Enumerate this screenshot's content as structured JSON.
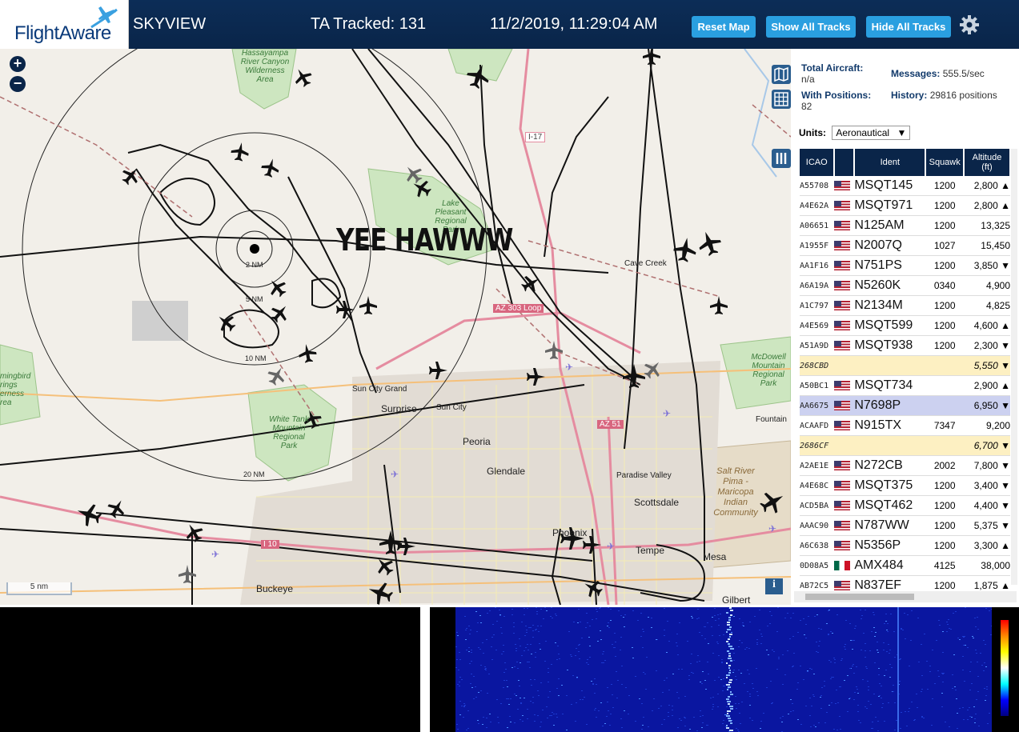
{
  "header": {
    "logo_text": "FlightAware",
    "title": "SKYVIEW",
    "tracked": "TA Tracked: 131",
    "datetime": "11/2/2019, 11:29:04 AM",
    "buttons": {
      "reset": "Reset Map",
      "show_all": "Show All Tracks",
      "hide_all": "Hide All Tracks"
    }
  },
  "map": {
    "overlay_text": "YEE HAWWW",
    "scale": "5 nm",
    "info": "i",
    "zoom_in": "+",
    "zoom_out": "−",
    "range_rings": [
      "2 NM",
      "5 NM",
      "10 NM",
      "20 NM"
    ],
    "places": {
      "surprise": "Surprise",
      "sun_city": "Sun City",
      "sun_city_grand": "Sun City Grand",
      "peoria": "Peoria",
      "glendale": "Glendale",
      "phoenix": "Phoenix",
      "scottsdale": "Scottsdale",
      "paradise_valley": "Paradise Valley",
      "tempe": "Tempe",
      "mesa": "Mesa",
      "buckeye": "Buckeye",
      "cave_creek": "Cave Creek",
      "fountain": "Fountain",
      "gilbert": "Gilbert",
      "hassayampa": "Hassayampa River Canyon Wilderness Area",
      "lake_pleasant": "Lake Pleasant Regional Park",
      "white_tank": "White Tank Mountain Regional Park",
      "mcdowell": "McDowell Mountain Regional Park",
      "salt_river": "Salt River Pima - Maricopa Indian Community",
      "hummingbird": "mingbird rings erness rea"
    },
    "roads": {
      "i17": "I-17",
      "az303": "AZ 303 Loop",
      "az51": "AZ 51",
      "i10": "I 10"
    }
  },
  "panel": {
    "total_label": "Total Aircraft:",
    "total_value": "n/a",
    "positions_label": "With Positions:",
    "positions_value": "82",
    "messages_label": "Messages:",
    "messages_value": "555.5/sec",
    "history_label": "History:",
    "history_value": "29816 positions",
    "units_label": "Units:",
    "units_value": "Aeronautical",
    "columns": {
      "icao": "ICAO",
      "ident": "Ident",
      "squawk": "Squawk",
      "altitude": "Altitude (ft)"
    },
    "rows": [
      {
        "icao": "A55708",
        "flag": "us",
        "ident": "MSQT145",
        "squawk": "1200",
        "alt": "2,800 ▲"
      },
      {
        "icao": "A4E62A",
        "flag": "us",
        "ident": "MSQT971",
        "squawk": "1200",
        "alt": "2,800 ▲"
      },
      {
        "icao": "A06651",
        "flag": "us",
        "ident": "N125AM",
        "squawk": "1200",
        "alt": "13,325"
      },
      {
        "icao": "A1955F",
        "flag": "us",
        "ident": "N2007Q",
        "squawk": "1027",
        "alt": "15,450"
      },
      {
        "icao": "AA1F16",
        "flag": "us",
        "ident": "N751PS",
        "squawk": "1200",
        "alt": "3,850 ▼"
      },
      {
        "icao": "A6A19A",
        "flag": "us",
        "ident": "N5260K",
        "squawk": "0340",
        "alt": "4,900"
      },
      {
        "icao": "A1C797",
        "flag": "us",
        "ident": "N2134M",
        "squawk": "1200",
        "alt": "4,825"
      },
      {
        "icao": "A4E569",
        "flag": "us",
        "ident": "MSQT599",
        "squawk": "1200",
        "alt": "4,600 ▲"
      },
      {
        "icao": "A51A9D",
        "flag": "us",
        "ident": "MSQT938",
        "squawk": "1200",
        "alt": "2,300 ▼"
      },
      {
        "icao": "268CBD",
        "flag": "",
        "ident": "",
        "squawk": "",
        "alt": "5,550 ▼",
        "style": "hl"
      },
      {
        "icao": "A50BC1",
        "flag": "us",
        "ident": "MSQT734",
        "squawk": "",
        "alt": "2,900 ▲"
      },
      {
        "icao": "AA6675",
        "flag": "us",
        "ident": "N7698P",
        "squawk": "",
        "alt": "6,950 ▼",
        "style": "sel"
      },
      {
        "icao": "ACAAFD",
        "flag": "us",
        "ident": "N915TX",
        "squawk": "7347",
        "alt": "9,200"
      },
      {
        "icao": "2686CF",
        "flag": "",
        "ident": "",
        "squawk": "",
        "alt": "6,700 ▼",
        "style": "hl"
      },
      {
        "icao": "A2AE1E",
        "flag": "us",
        "ident": "N272CB",
        "squawk": "2002",
        "alt": "7,800 ▼"
      },
      {
        "icao": "A4E68C",
        "flag": "us",
        "ident": "MSQT375",
        "squawk": "1200",
        "alt": "3,400 ▼"
      },
      {
        "icao": "ACD5BA",
        "flag": "us",
        "ident": "MSQT462",
        "squawk": "1200",
        "alt": "4,400 ▼"
      },
      {
        "icao": "AAAC90",
        "flag": "us",
        "ident": "N787WW",
        "squawk": "1200",
        "alt": "5,375 ▼"
      },
      {
        "icao": "A6C638",
        "flag": "us",
        "ident": "N5356P",
        "squawk": "1200",
        "alt": "3,300 ▲"
      },
      {
        "icao": "0D08A5",
        "flag": "mx",
        "ident": "AMX484",
        "squawk": "4125",
        "alt": "38,000"
      },
      {
        "icao": "AB72C5",
        "flag": "us",
        "ident": "N837EF",
        "squawk": "1200",
        "alt": "1,875 ▲"
      }
    ]
  },
  "colors": {
    "header_bg": "#0a2549",
    "button": "#2a9fe0",
    "highlight_row": "#fdf0c2",
    "selected_row": "#ccd1f0"
  },
  "icons": {
    "gear": "gear-icon",
    "map_type": "map-icon",
    "grid": "grid-icon",
    "columns": "columns-icon",
    "plane": "airplane-icon"
  }
}
